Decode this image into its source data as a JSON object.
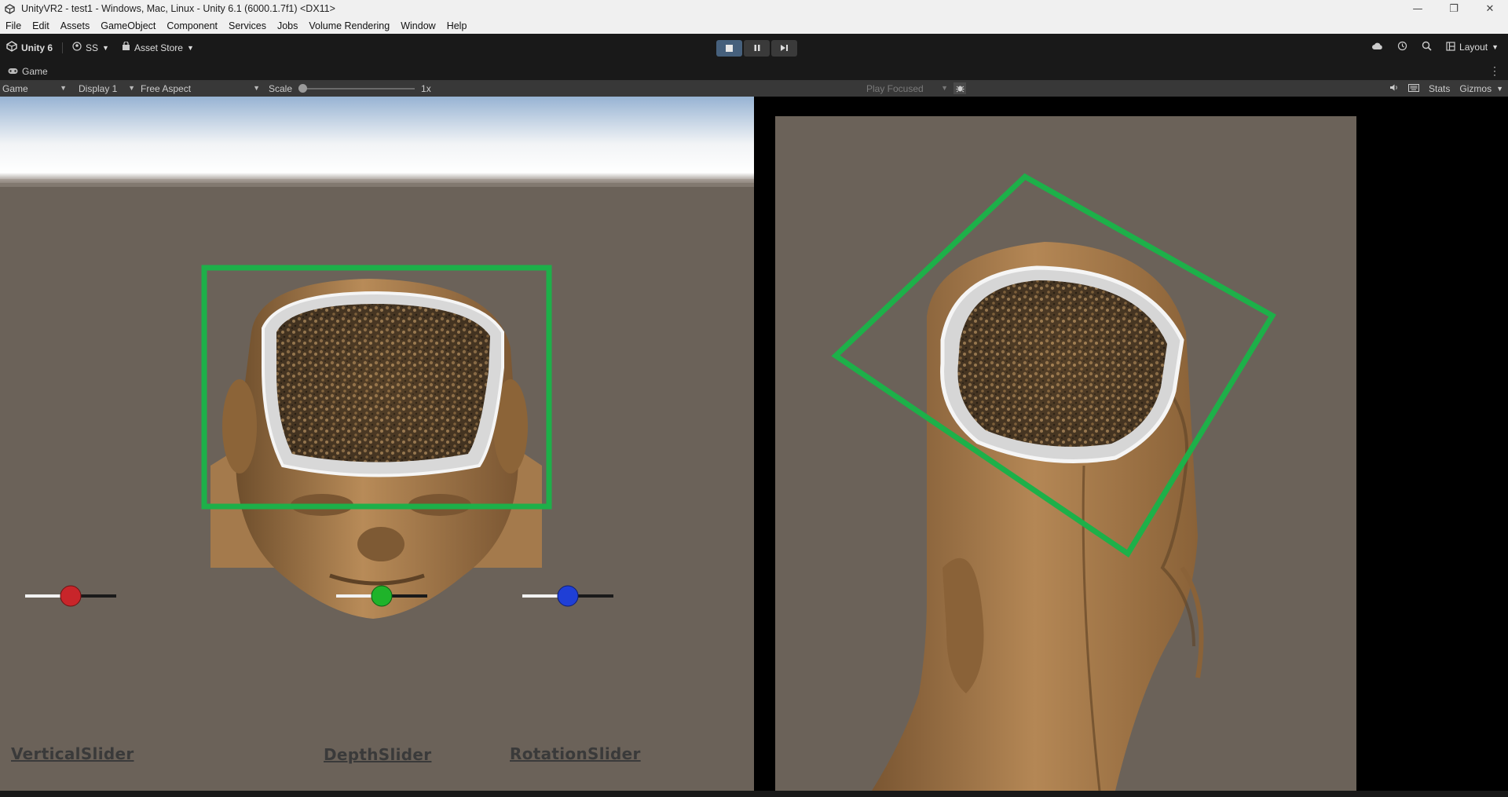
{
  "window": {
    "title": "UnityVR2 - test1 - Windows, Mac, Linux - Unity 6.1 (6000.1.7f1) <DX11>",
    "controls": [
      "minimize-icon",
      "restore-icon",
      "close-icon"
    ]
  },
  "menu": [
    "File",
    "Edit",
    "Assets",
    "GameObject",
    "Component",
    "Services",
    "Jobs",
    "Volume Rendering",
    "Window",
    "Help"
  ],
  "toolbar": {
    "product": "Unity 6",
    "account": "SS",
    "asset_store": "Asset Store",
    "layout": "Layout",
    "play_state": "playing"
  },
  "tab": {
    "label": "Game"
  },
  "gamebar": {
    "mode": "Game",
    "display": "Display 1",
    "aspect": "Free Aspect",
    "scale_label": "Scale",
    "scale_value": "1x",
    "scale_level": 0,
    "play_mode": "Play Focused",
    "stats": "Stats",
    "gizmos": "Gizmos"
  },
  "sliders": [
    {
      "label": "VerticalSlider",
      "color": "#c8252a",
      "value": 0.5
    },
    {
      "label": "DepthSlider",
      "color": "#1fb32a",
      "value": 0.5
    },
    {
      "label": "RotationSlider",
      "color": "#1f3fd6",
      "value": 0.5
    }
  ],
  "colors": {
    "selection_box": "#1db049",
    "skin": "#a47a4c",
    "ground": "#6b6259",
    "sky_top": "#97b3d3"
  }
}
